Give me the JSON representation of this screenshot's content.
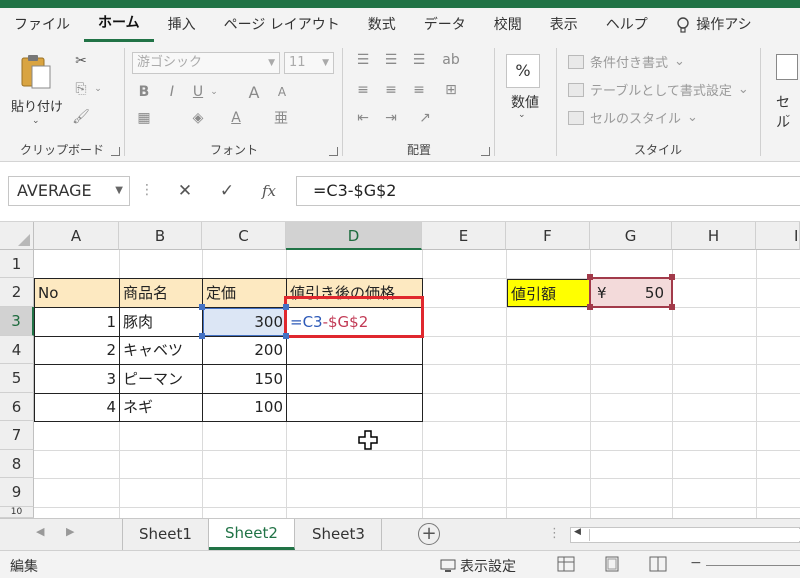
{
  "ribbon_tabs": [
    "ファイル",
    "ホーム",
    "挿入",
    "ページ レイアウト",
    "数式",
    "データ",
    "校閲",
    "表示",
    "ヘルプ"
  ],
  "tell_me": "操作アシ",
  "clipboard": {
    "paste": "貼り付け",
    "label": "クリップボード"
  },
  "font": {
    "name": "游ゴシック",
    "size": "11",
    "label": "フォント",
    "bold": "B",
    "italic": "I",
    "underline": "U",
    "grow": "A",
    "shrink": "A"
  },
  "alignment": {
    "label": "配置"
  },
  "number": {
    "percent": "%",
    "label": "数値"
  },
  "styles": {
    "label": "スタイル",
    "items": [
      "条件付き書式",
      "テーブルとして書式設定",
      "セルのスタイル"
    ]
  },
  "cells": {
    "label": "セル"
  },
  "formula_bar": {
    "name_box": "AVERAGE",
    "cancel": "✕",
    "enter": "✓",
    "fx": "fx",
    "formula": "=C3-$G$2"
  },
  "columns": [
    "A",
    "B",
    "C",
    "D",
    "E",
    "F",
    "G",
    "H",
    "I"
  ],
  "rows": [
    "1",
    "2",
    "3",
    "4",
    "5",
    "6",
    "7",
    "8",
    "9",
    "10"
  ],
  "table": {
    "headers": [
      "No",
      "商品名",
      "定価",
      "値引き後の価格"
    ],
    "rows": [
      {
        "no": "1",
        "name": "豚肉",
        "price": "300"
      },
      {
        "no": "2",
        "name": "キャベツ",
        "price": "200"
      },
      {
        "no": "3",
        "name": "ピーマン",
        "price": "150"
      },
      {
        "no": "4",
        "name": "ネギ",
        "price": "100"
      }
    ]
  },
  "editing_cell": {
    "ref_c": "=C3",
    "ref_g": "-$G$2"
  },
  "discount": {
    "label": "値引額",
    "currency": "¥",
    "value": "50"
  },
  "sheets": [
    "Sheet1",
    "Sheet2",
    "Sheet3"
  ],
  "active_sheet": "Sheet2",
  "status": {
    "mode": "編集",
    "display_settings": "表示設定"
  },
  "colors": {
    "excel_green": "#217346",
    "header_fill": "#fde9c1",
    "label_yellow": "#ffff00",
    "value_pink": "#f3dada",
    "highlight_red": "#e0282e"
  }
}
